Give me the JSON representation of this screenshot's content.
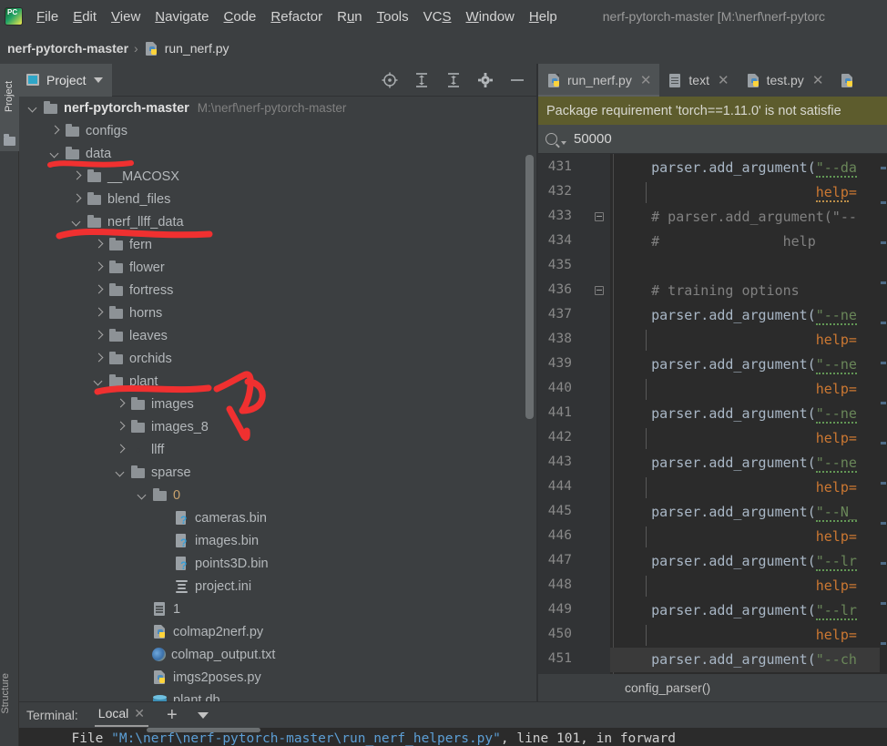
{
  "app": {
    "logo_icon": "pycharm-logo-icon",
    "window_title": "nerf-pytorch-master [M:\\nerf\\nerf-pytorc",
    "menu": [
      {
        "label": "File",
        "mnemonic": "F"
      },
      {
        "label": "Edit",
        "mnemonic": "E"
      },
      {
        "label": "View",
        "mnemonic": "V"
      },
      {
        "label": "Navigate",
        "mnemonic": "N"
      },
      {
        "label": "Code",
        "mnemonic": "C"
      },
      {
        "label": "Refactor",
        "mnemonic": "R"
      },
      {
        "label": "Run",
        "mnemonic": "u"
      },
      {
        "label": "Tools",
        "mnemonic": "T"
      },
      {
        "label": "VCS",
        "mnemonic": "S"
      },
      {
        "label": "Window",
        "mnemonic": "W"
      },
      {
        "label": "Help",
        "mnemonic": "H"
      }
    ]
  },
  "breadcrumb": {
    "project": "nerf-pytorch-master",
    "separator": "›",
    "file": "run_nerf.py",
    "file_icon": "python-file-icon"
  },
  "left_strip": {
    "project_tab": "Project",
    "structure_tab": "Structure"
  },
  "project_panel": {
    "title": "Project",
    "title_icon": "project-view-icon",
    "dropdown_icon": "chevron-down-icon",
    "tools": [
      {
        "name": "locate-icon",
        "label": "Select Opened File"
      },
      {
        "name": "expand-all-icon",
        "label": "Expand All"
      },
      {
        "name": "collapse-all-icon",
        "label": "Collapse All"
      },
      {
        "name": "gear-icon",
        "label": "Settings"
      },
      {
        "name": "minimize-icon",
        "label": "Hide"
      }
    ],
    "tree": [
      {
        "label": "nerf-pytorch-master",
        "hint": "M:\\nerf\\nerf-pytorch-master",
        "icon": "folder",
        "state": "expanded",
        "depth": 0,
        "root": true
      },
      {
        "label": "configs",
        "icon": "folder",
        "state": "collapsed",
        "depth": 1
      },
      {
        "label": "data",
        "icon": "folder",
        "state": "expanded",
        "depth": 1
      },
      {
        "label": "__MACOSX",
        "icon": "folder",
        "state": "collapsed",
        "depth": 2
      },
      {
        "label": "blend_files",
        "icon": "folder",
        "state": "collapsed",
        "depth": 2
      },
      {
        "label": "nerf_llff_data",
        "icon": "folder",
        "state": "expanded",
        "depth": 2
      },
      {
        "label": "fern",
        "icon": "folder",
        "state": "collapsed",
        "depth": 3
      },
      {
        "label": "flower",
        "icon": "folder",
        "state": "collapsed",
        "depth": 3
      },
      {
        "label": "fortress",
        "icon": "folder",
        "state": "collapsed",
        "depth": 3
      },
      {
        "label": "horns",
        "icon": "folder",
        "state": "collapsed",
        "depth": 3
      },
      {
        "label": "leaves",
        "icon": "folder",
        "state": "collapsed",
        "depth": 3
      },
      {
        "label": "orchids",
        "icon": "folder",
        "state": "collapsed",
        "depth": 3
      },
      {
        "label": "plant",
        "icon": "folder",
        "state": "expanded",
        "depth": 3
      },
      {
        "label": "images",
        "icon": "folder",
        "state": "collapsed",
        "depth": 4
      },
      {
        "label": "images_8",
        "icon": "folder",
        "state": "collapsed",
        "depth": 4
      },
      {
        "label": "llff",
        "icon": "folder-src",
        "state": "collapsed",
        "depth": 4
      },
      {
        "label": "sparse",
        "icon": "folder",
        "state": "expanded",
        "depth": 4
      },
      {
        "label": "0",
        "icon": "folder",
        "state": "expanded",
        "depth": 5,
        "numeric": true
      },
      {
        "label": "cameras.bin",
        "icon": "binfile",
        "state": "leaf",
        "depth": 6
      },
      {
        "label": "images.bin",
        "icon": "binfile",
        "state": "leaf",
        "depth": 6
      },
      {
        "label": "points3D.bin",
        "icon": "binfile",
        "state": "leaf",
        "depth": 6
      },
      {
        "label": "project.ini",
        "icon": "inifile",
        "state": "leaf",
        "depth": 6
      },
      {
        "label": "1",
        "icon": "txtfile",
        "state": "leaf",
        "depth": 5
      },
      {
        "label": "colmap2nerf.py",
        "icon": "pyfile",
        "state": "leaf",
        "depth": 5
      },
      {
        "label": "colmap_output.txt",
        "icon": "colmap",
        "state": "leaf",
        "depth": 5
      },
      {
        "label": "imgs2poses.py",
        "icon": "pyfile",
        "state": "leaf",
        "depth": 5
      },
      {
        "label": "plant.db",
        "icon": "dbfile",
        "state": "leaf",
        "depth": 5
      }
    ]
  },
  "annotations": {
    "color": "#f03030",
    "marks": [
      {
        "name": "underline-data",
        "type": "underline"
      },
      {
        "name": "underline-nerf-llff-data",
        "type": "underline"
      },
      {
        "name": "underline-plant",
        "type": "underline"
      },
      {
        "name": "arrow-scribble",
        "type": "arrow"
      }
    ]
  },
  "editor": {
    "tabs": [
      {
        "label": "run_nerf.py",
        "icon": "python-file-icon",
        "active": true,
        "close_icon": "close-icon"
      },
      {
        "label": "text",
        "icon": "text-file-icon",
        "active": false,
        "close_icon": "close-icon"
      },
      {
        "label": "test.py",
        "icon": "python-file-icon",
        "active": false,
        "close_icon": "close-icon"
      },
      {
        "label": "",
        "icon": "python-file-icon",
        "active": false,
        "close_icon": "close-icon"
      }
    ],
    "notification": "Package requirement 'torch==1.11.0' is not satisfie",
    "find": {
      "icon": "search-icon",
      "value": "50000",
      "placeholder": "Search"
    },
    "bottom_breadcrumb": "config_parser()",
    "lines": [
      {
        "num": "431",
        "fold": "none",
        "segments": [
          {
            "t": "    parser.add_argument(",
            "c": "c-id"
          },
          {
            "t": "\"--da",
            "c": "c-str underline-green"
          }
        ]
      },
      {
        "num": "432",
        "fold": "none",
        "segments": [
          {
            "t": "                        ",
            "c": "c-plain"
          },
          {
            "t": "help",
            "c": "c-kwarg underline-orange"
          },
          {
            "t": "=",
            "c": "c-kwarg"
          }
        ]
      },
      {
        "num": "433",
        "fold": "minus",
        "segments": [
          {
            "t": "    # parser.add_argument(\"--",
            "c": "c-comment"
          }
        ]
      },
      {
        "num": "434",
        "fold": "none",
        "segments": [
          {
            "t": "    #               help",
            "c": "c-comment"
          }
        ]
      },
      {
        "num": "435",
        "fold": "none",
        "segments": []
      },
      {
        "num": "436",
        "fold": "minus",
        "segments": [
          {
            "t": "    # training options",
            "c": "c-comment"
          }
        ]
      },
      {
        "num": "437",
        "fold": "none",
        "segments": [
          {
            "t": "    parser.add_argument(",
            "c": "c-id"
          },
          {
            "t": "\"--ne",
            "c": "c-str underline-green"
          }
        ]
      },
      {
        "num": "438",
        "fold": "none",
        "segments": [
          {
            "t": "                        ",
            "c": "c-plain"
          },
          {
            "t": "help",
            "c": "c-kwarg"
          },
          {
            "t": "=",
            "c": "c-kwarg"
          }
        ]
      },
      {
        "num": "439",
        "fold": "none",
        "segments": [
          {
            "t": "    parser.add_argument(",
            "c": "c-id"
          },
          {
            "t": "\"--ne",
            "c": "c-str underline-green"
          }
        ]
      },
      {
        "num": "440",
        "fold": "none",
        "segments": [
          {
            "t": "                        ",
            "c": "c-plain"
          },
          {
            "t": "help",
            "c": "c-kwarg"
          },
          {
            "t": "=",
            "c": "c-kwarg"
          }
        ]
      },
      {
        "num": "441",
        "fold": "none",
        "segments": [
          {
            "t": "    parser.add_argument(",
            "c": "c-id"
          },
          {
            "t": "\"--ne",
            "c": "c-str underline-green"
          }
        ]
      },
      {
        "num": "442",
        "fold": "none",
        "segments": [
          {
            "t": "                        ",
            "c": "c-plain"
          },
          {
            "t": "help",
            "c": "c-kwarg"
          },
          {
            "t": "=",
            "c": "c-kwarg"
          }
        ]
      },
      {
        "num": "443",
        "fold": "none",
        "segments": [
          {
            "t": "    parser.add_argument(",
            "c": "c-id"
          },
          {
            "t": "\"--ne",
            "c": "c-str underline-green"
          }
        ]
      },
      {
        "num": "444",
        "fold": "none",
        "segments": [
          {
            "t": "                        ",
            "c": "c-plain"
          },
          {
            "t": "help",
            "c": "c-kwarg"
          },
          {
            "t": "=",
            "c": "c-kwarg"
          }
        ]
      },
      {
        "num": "445",
        "fold": "none",
        "segments": [
          {
            "t": "    parser.add_argument(",
            "c": "c-id"
          },
          {
            "t": "\"--N_",
            "c": "c-str underline-green"
          }
        ]
      },
      {
        "num": "446",
        "fold": "none",
        "segments": [
          {
            "t": "                        ",
            "c": "c-plain"
          },
          {
            "t": "help",
            "c": "c-kwarg"
          },
          {
            "t": "=",
            "c": "c-kwarg"
          }
        ]
      },
      {
        "num": "447",
        "fold": "none",
        "segments": [
          {
            "t": "    parser.add_argument(",
            "c": "c-id"
          },
          {
            "t": "\"--lr",
            "c": "c-str underline-green"
          }
        ]
      },
      {
        "num": "448",
        "fold": "none",
        "segments": [
          {
            "t": "                        ",
            "c": "c-plain"
          },
          {
            "t": "help",
            "c": "c-kwarg"
          },
          {
            "t": "=",
            "c": "c-kwarg"
          }
        ]
      },
      {
        "num": "449",
        "fold": "none",
        "segments": [
          {
            "t": "    parser.add_argument(",
            "c": "c-id"
          },
          {
            "t": "\"--lr",
            "c": "c-str underline-green"
          }
        ]
      },
      {
        "num": "450",
        "fold": "none",
        "segments": [
          {
            "t": "                        ",
            "c": "c-plain"
          },
          {
            "t": "help",
            "c": "c-kwarg"
          },
          {
            "t": "=",
            "c": "c-kwarg"
          }
        ]
      },
      {
        "num": "451",
        "fold": "none",
        "highlight": true,
        "segments": [
          {
            "t": "    parser.add_argument(",
            "c": "c-id"
          },
          {
            "t": "\"--ch",
            "c": "c-str"
          }
        ]
      }
    ]
  },
  "terminal": {
    "label": "Terminal:",
    "tab": "Local",
    "close_icon": "close-icon",
    "add_icon": "plus-icon",
    "menu_icon": "chevron-down-icon",
    "output": [
      {
        "t": "  File ",
        "c": "t-white"
      },
      {
        "t": "\"M:\\nerf\\nerf-pytorch-master\\run_nerf_helpers.py\"",
        "c": "t-blue"
      },
      {
        "t": ", line 101, in forward",
        "c": "t-white"
      }
    ]
  }
}
